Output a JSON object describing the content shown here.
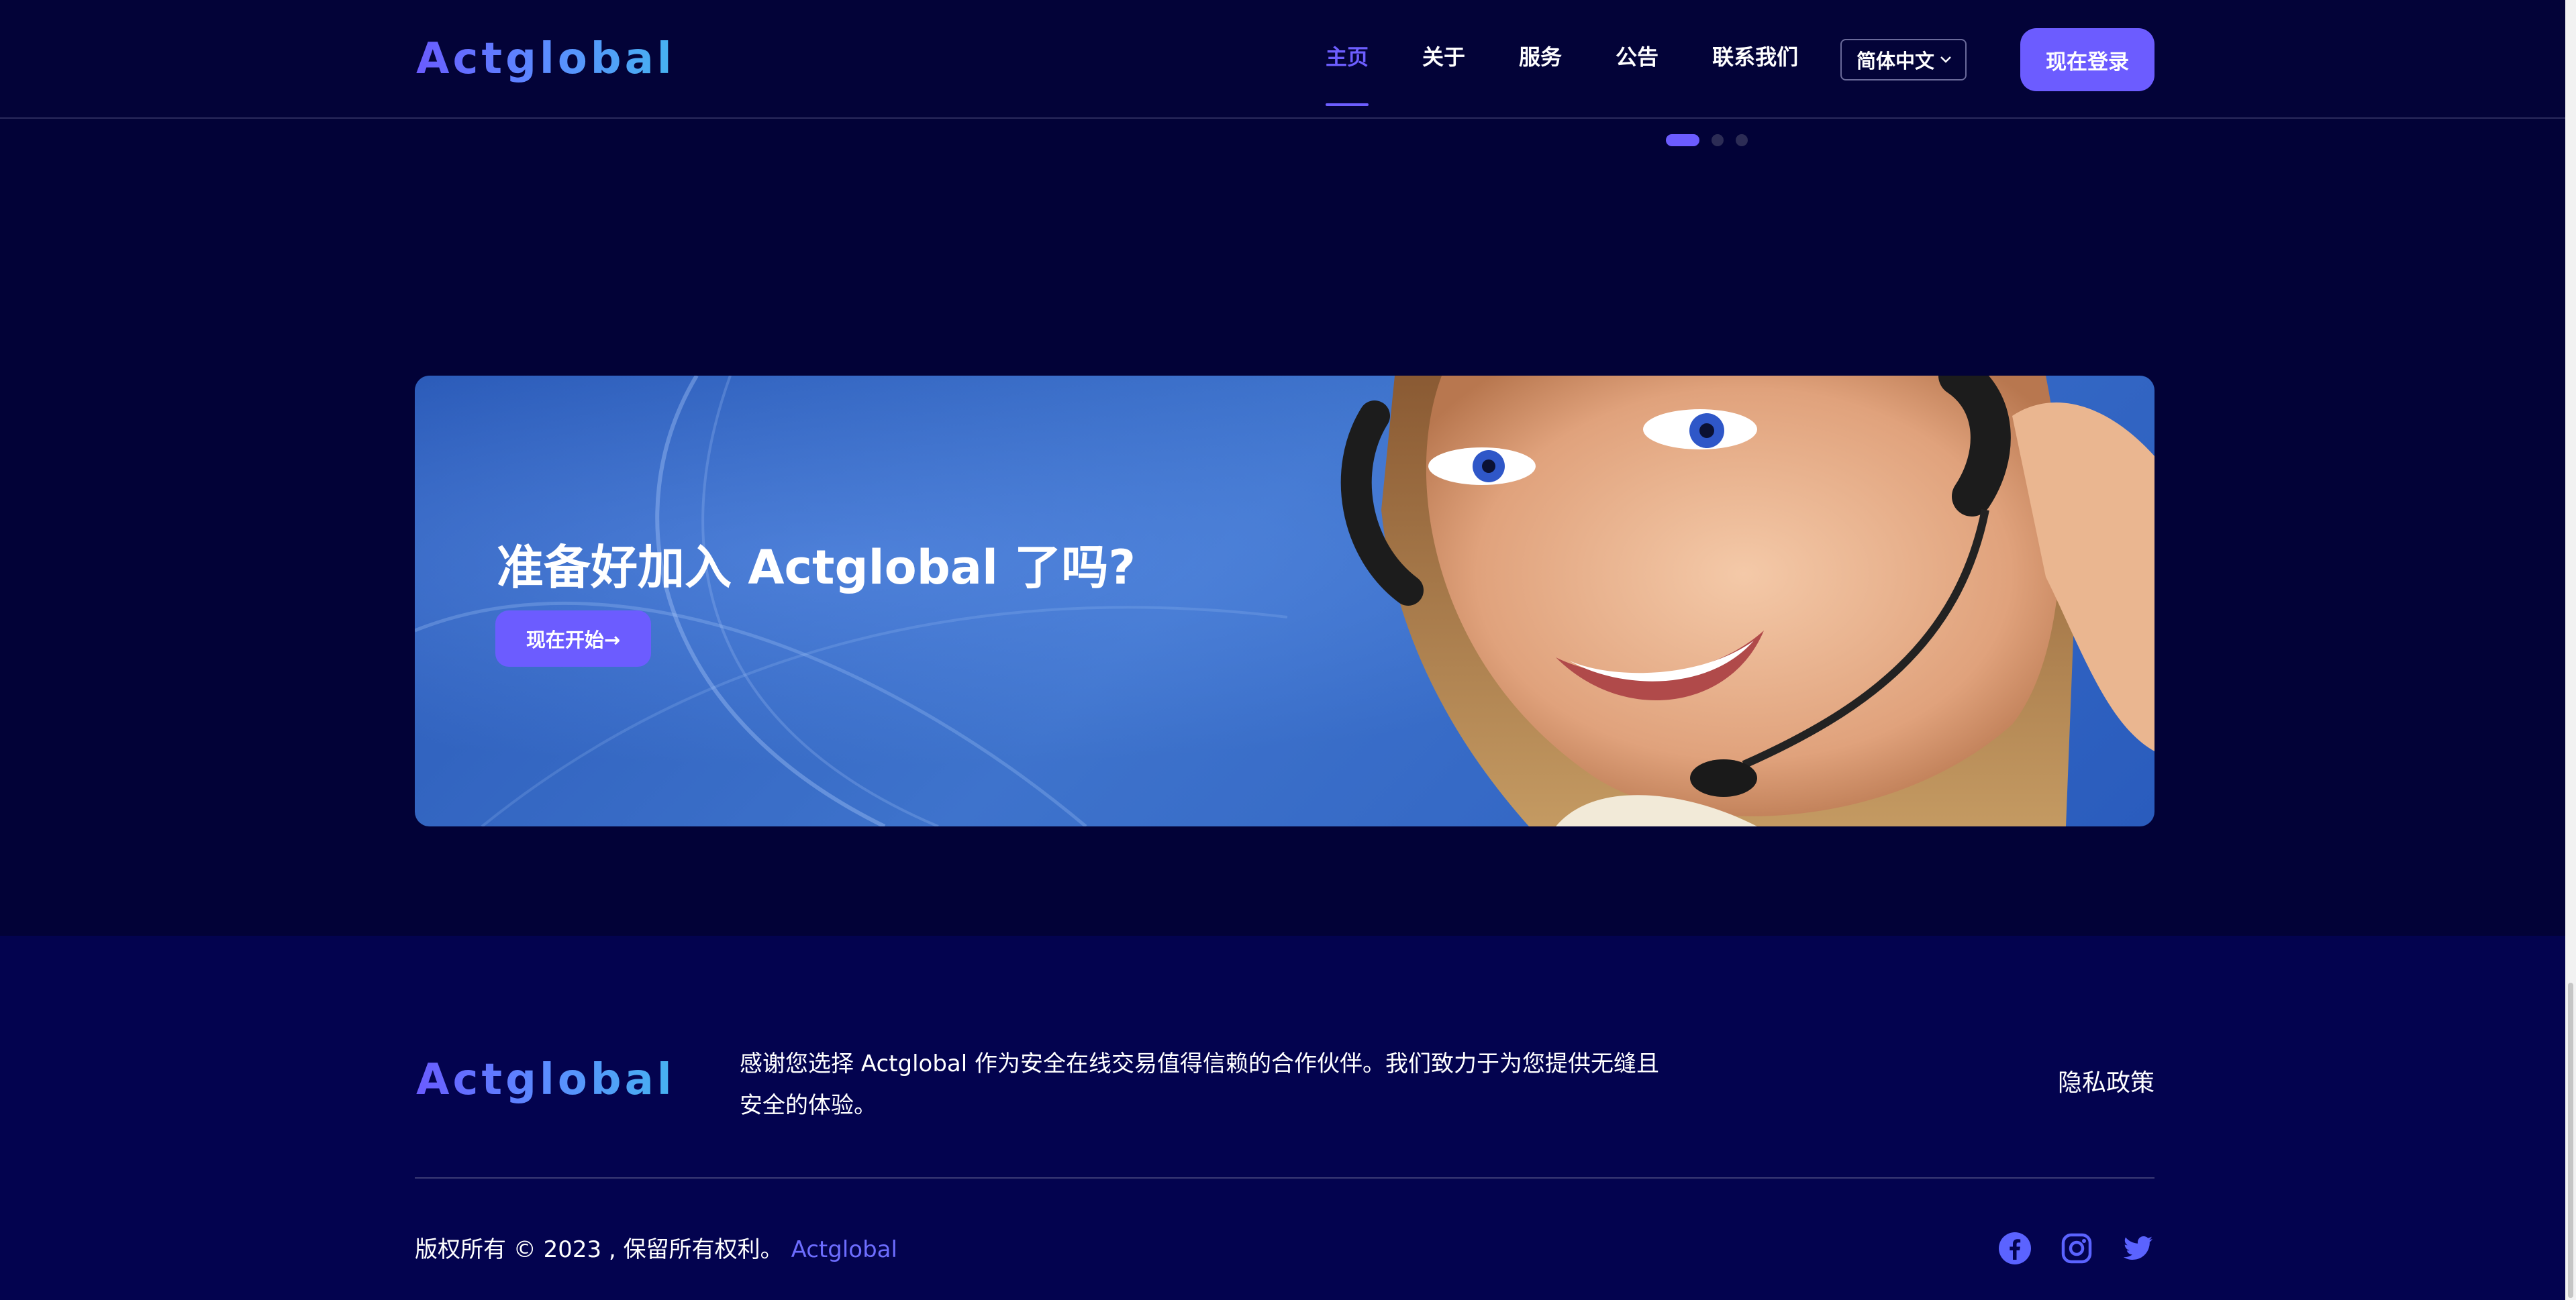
{
  "header": {
    "logo": "Actglobal",
    "nav": [
      "主页",
      "关于",
      "服务",
      "公告",
      "联系我们"
    ],
    "active_nav_index": 0,
    "language": "简体中文",
    "login_label": "现在登录"
  },
  "carousel": {
    "slides": 3,
    "active_slide": 1
  },
  "banner": {
    "title": "准备好加入 Actglobal 了吗?",
    "button_label": "现在开始→"
  },
  "footer": {
    "logo": "Actglobal",
    "description": "感谢您选择 Actglobal 作为安全在线交易值得信赖的合作伙伴。我们致力于为您提供无缝且安全的体验。",
    "privacy_label": "隐私政策",
    "copyright_text": "版权所有 © 2023 , 保留所有权利。",
    "copyright_brand": "Actglobal",
    "socials": [
      "facebook-icon",
      "instagram-icon",
      "twitter-icon"
    ]
  },
  "colors": {
    "background": "#020237",
    "footer_background": "#03034f",
    "accent": "#6c5cff"
  }
}
